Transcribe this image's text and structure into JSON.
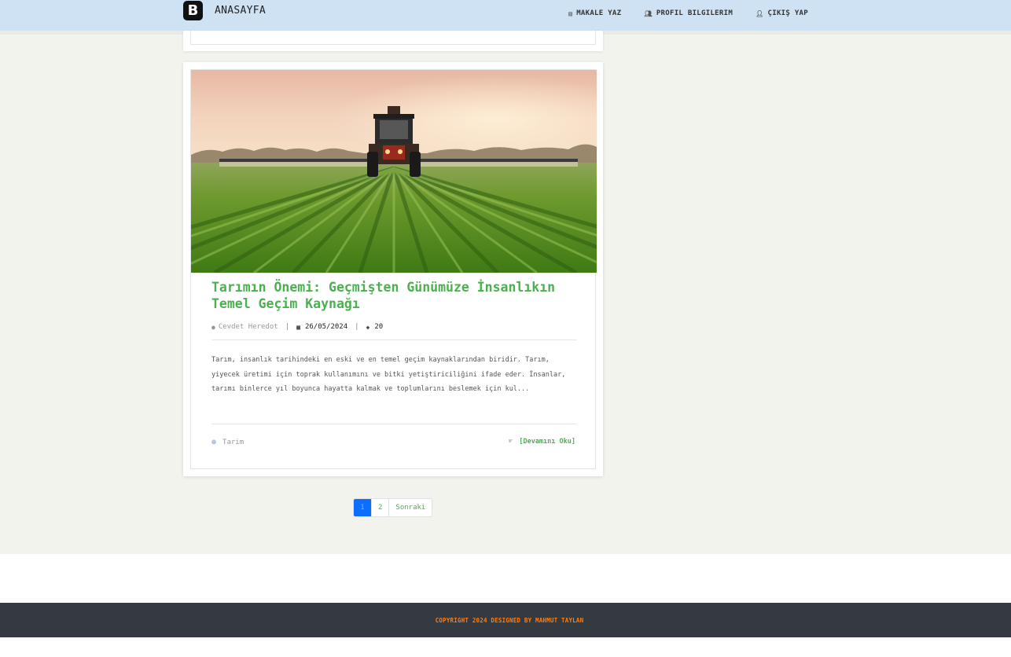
{
  "navbar": {
    "brand_logo_letter": "B",
    "brand_text": "ANASAYFA",
    "links": [
      {
        "label": "MAKALE YAZ",
        "icon": "document-icon"
      },
      {
        "label": "PROFIL BILGILERIM",
        "icon": "users-icon"
      },
      {
        "label": "ÇIKIŞ YAP",
        "icon": "user-logout-icon"
      }
    ]
  },
  "post": {
    "image_alt": "Tractor spraying a green field at sunset",
    "title": "Tarımın Önemi: Geçmişten Günümüze İnsanlıkın Temel Geçim Kaynağı",
    "author": "Cevdet Heredot",
    "date": "26/05/2024",
    "views": "20",
    "excerpt": "Tarım, insanlık tarihindeki en eski ve en temel geçim kaynaklarından biridir. Tarım, yiyecek üretimi için toprak kullanımını ve bitki yetiştiriciliğini ifade eder. İnsanlar, tarımı binlerce yıl boyunca hayatta kalmak ve toplumlarını beslemek için kul...",
    "tag": "Tarim",
    "read_more": "[Devamını Oku]"
  },
  "pagination": {
    "pages": [
      "1",
      "2"
    ],
    "next": "Sonraki",
    "active": "1"
  },
  "footer": {
    "text": "COPYRIGHT 2024 DESIGNED BY MAHMUT TAYLAN"
  },
  "colors": {
    "navbar_bg": "#cfe2f3",
    "accent_green": "#4caf50",
    "active_page": "#0d6efd",
    "footer_bg": "#343a40",
    "footer_text": "#fd7e14"
  }
}
